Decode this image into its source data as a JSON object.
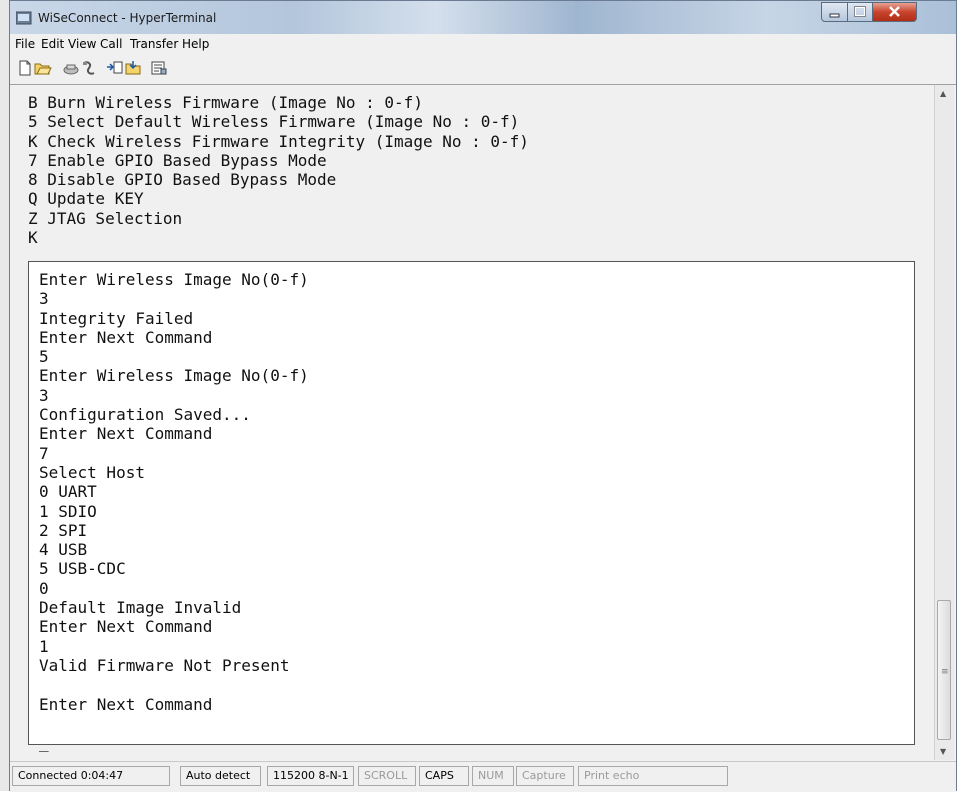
{
  "window": {
    "title": "WiSeConnect - HyperTerminal"
  },
  "menubar": {
    "items": [
      "File",
      "Edit",
      "View",
      "Call",
      "Transfer",
      "Help"
    ]
  },
  "terminal": {
    "upper_lines": [
      "B Burn Wireless Firmware (Image No : 0-f)",
      "5 Select Default Wireless Firmware (Image No : 0-f)",
      "K Check Wireless Firmware Integrity (Image No : 0-f)",
      "7 Enable GPIO Based Bypass Mode",
      "8 Disable GPIO Based Bypass Mode",
      "Q Update KEY",
      "Z JTAG Selection",
      "K"
    ],
    "lower_lines": [
      "Enter Wireless Image No(0-f)",
      "3",
      "Integrity Failed",
      "Enter Next Command",
      "5",
      "Enter Wireless Image No(0-f)",
      "3",
      "Configuration Saved...",
      "Enter Next Command",
      "7",
      "Select Host",
      "0 UART",
      "1 SDIO",
      "2 SPI",
      "4 USB",
      "5 USB-CDC",
      "0",
      "Default Image Invalid",
      "Enter Next Command",
      "1",
      "Valid Firmware Not Present",
      "",
      "Enter Next Command",
      "",
      "_"
    ]
  },
  "statusbar": {
    "connection": "Connected 0:04:47",
    "detect": "Auto detect",
    "settings": "115200 8-N-1",
    "scroll": "SCROLL",
    "caps": "CAPS",
    "num": "NUM",
    "capture": "Capture",
    "print_echo": "Print echo"
  },
  "icons": {
    "toolbar": [
      "new-icon",
      "open-icon",
      "call-icon",
      "disconnect-icon",
      "send-icon",
      "receive-icon",
      "properties-icon"
    ]
  }
}
